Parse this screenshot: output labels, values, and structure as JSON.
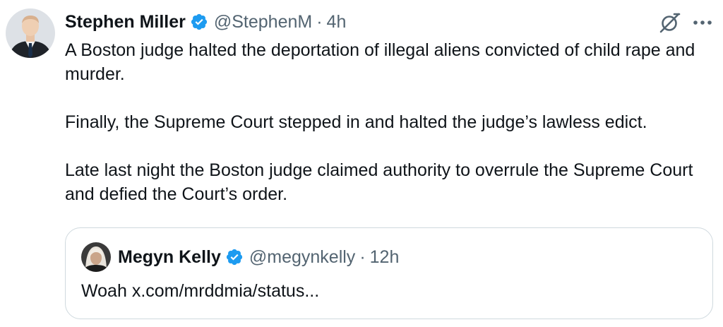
{
  "tweet": {
    "author_name": "Stephen Miller",
    "handle": "@StephenM",
    "separator": "·",
    "time": "4h",
    "paragraphs": [
      "A Boston judge halted the deportation of illegal aliens convicted of child rape and murder.",
      "Finally, the Supreme Court stepped in and halted the judge’s lawless edict.",
      "Late last night the Boston judge claimed authority to overrule the Supreme Court and defied the Court’s order."
    ]
  },
  "quote": {
    "author_name": "Megyn Kelly",
    "handle": "@megynkelly",
    "separator": "·",
    "time": "12h",
    "text_prefix": "Woah ",
    "link_text": "x.com/mrddmia/status..."
  },
  "colors": {
    "verified": "#1d9bf0",
    "secondary_text": "#536471",
    "border": "#cfd9de"
  },
  "icons": {
    "verified": "verified-badge-icon",
    "grok": "grok-icon",
    "more": "more-icon"
  }
}
